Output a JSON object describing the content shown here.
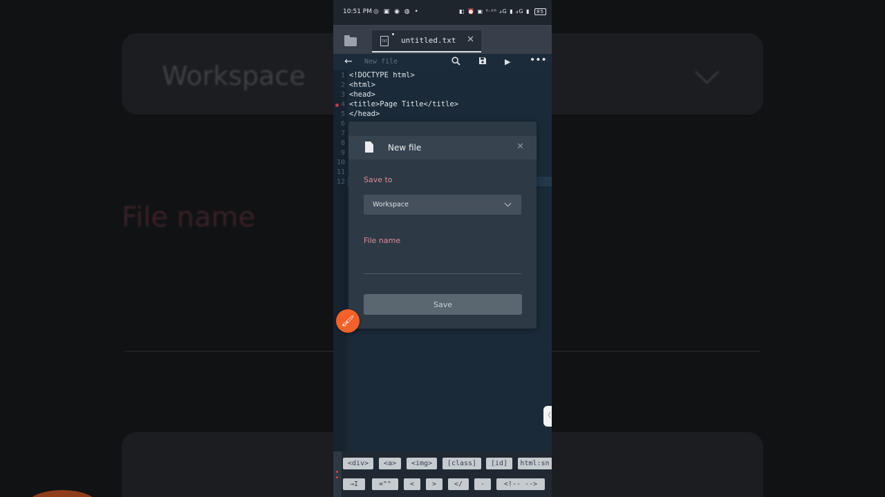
{
  "background": {
    "workspace_text": "Workspace",
    "filename_text": "File name"
  },
  "status_bar": {
    "time": "10:51 PM",
    "left_icons": "◎ ▣ ◉ ◍ •",
    "right_icons": "◧ ⏰ ▣ ⁰·⁰⁰ ₄G ▮ ₄G ▮",
    "battery": "85"
  },
  "tab": {
    "label": "untitled.txt",
    "file_icon_text": "TXT"
  },
  "toolbar": {
    "title": "New file"
  },
  "editor": {
    "line_numbers": [
      "1",
      "2",
      "3",
      "4",
      "5",
      "6",
      "7",
      "8",
      "9",
      "10",
      "11",
      "12"
    ],
    "lines": [
      "<!DOCTYPE html>",
      "<html>",
      "<head>",
      "<title>Page Title</title>",
      "</head>"
    ]
  },
  "dialog": {
    "title": "New file",
    "save_to_label": "Save to",
    "save_to_value": "Workspace",
    "file_name_label": "File name",
    "file_name_value": "",
    "save_button": "Save"
  },
  "quick_keys": {
    "row1": [
      "<div>",
      "<a>",
      "<img>",
      "[class]",
      "[id]",
      "html:sn"
    ],
    "row2": [
      "→I",
      "=\"\"",
      "<",
      ">",
      "</",
      "-",
      "<!-- -->"
    ]
  },
  "colors": {
    "accent_fab": "#f2612a",
    "label_pink": "#e48b94",
    "editor_bg": "#1a2a38"
  }
}
